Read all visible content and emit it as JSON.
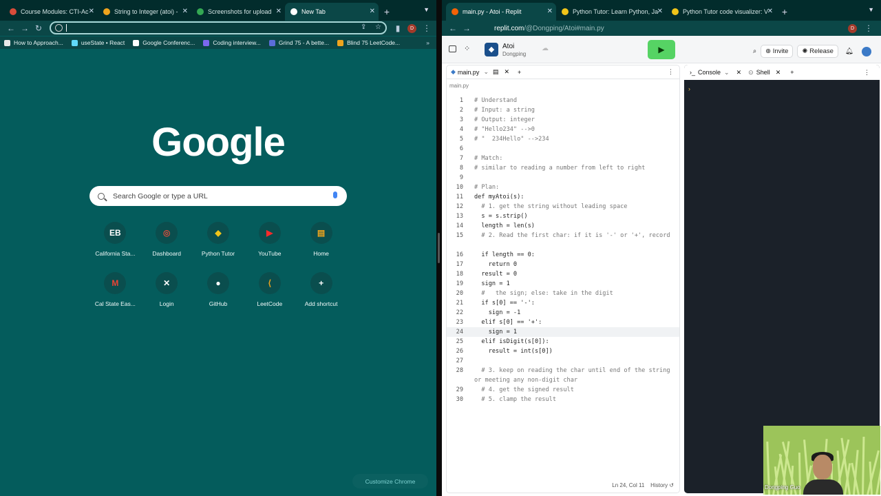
{
  "left": {
    "tabs": [
      {
        "title": "Course Modules: CTI-Ac",
        "color": "#d84c3a"
      },
      {
        "title": "String to Integer (atoi) -",
        "color": "#f0a41d"
      },
      {
        "title": "Screenshots for upload",
        "color": "#34a853"
      },
      {
        "title": "New Tab",
        "color": "#ffffff"
      }
    ],
    "bookmarks": [
      {
        "label": "How to Approach...",
        "color": "#e8e8e8"
      },
      {
        "label": "useState • React",
        "color": "#61dafb"
      },
      {
        "label": "Google Conferenc...",
        "color": "#ffffff"
      },
      {
        "label": "Coding interview...",
        "color": "#7b68ee"
      },
      {
        "label": "Grind 75 - A bette...",
        "color": "#5b6dd8"
      },
      {
        "label": "Blind 75 LeetCode...",
        "color": "#f0a41d"
      }
    ],
    "logo": "Google",
    "search_placeholder": "Search Google or type a URL",
    "shortcuts": [
      {
        "label": "California Sta...",
        "glyph": "EB",
        "color": "#ffffff"
      },
      {
        "label": "Dashboard",
        "glyph": "◎",
        "color": "#d84c3a"
      },
      {
        "label": "Python Tutor",
        "glyph": "◆",
        "color": "#f0c419"
      },
      {
        "label": "YouTube",
        "glyph": "▶",
        "color": "#ff2a2a"
      },
      {
        "label": "Home",
        "glyph": "▤",
        "color": "#f0a41d"
      },
      {
        "label": "Cal State Eas...",
        "glyph": "M",
        "color": "#ea4335"
      },
      {
        "label": "Login",
        "glyph": "✕",
        "color": "#ffffff"
      },
      {
        "label": "GitHub",
        "glyph": "●",
        "color": "#ffffff"
      },
      {
        "label": "LeetCode",
        "glyph": "⟨",
        "color": "#f0a41d"
      },
      {
        "label": "Add shortcut",
        "glyph": "+",
        "color": "#ffffff"
      }
    ],
    "customize": "Customize Chrome"
  },
  "right": {
    "tabs": [
      {
        "title": "main.py - Atoi - Replit",
        "color": "#f26207"
      },
      {
        "title": "Python Tutor: Learn Python, Ja",
        "color": "#f0c419"
      },
      {
        "title": "Python Tutor code visualizer: V",
        "color": "#f0c419"
      }
    ],
    "url_host": "replit.com",
    "url_path": "/@Dongping/Atoi#main.py",
    "repl_name": "Atoi",
    "repl_owner": "Dongping",
    "invite": "Invite",
    "release": "Release",
    "file_tab": "main.py",
    "file_path": "main.py",
    "console_tab": "Console",
    "shell_tab": "Shell",
    "status": "Ln 24, Col 11",
    "history": "History",
    "webcam_name": "Dongping Guo",
    "code": [
      {
        "n": "1",
        "t": "# Understand",
        "c": true
      },
      {
        "n": "2",
        "t": "# Input: a string",
        "c": true
      },
      {
        "n": "3",
        "t": "# Output: integer",
        "c": true
      },
      {
        "n": "4",
        "t": "# \"Hello234\" -->0",
        "c": true
      },
      {
        "n": "5",
        "t": "# \"  234Hello\" -->234",
        "c": true
      },
      {
        "n": "6",
        "t": "",
        "c": false
      },
      {
        "n": "7",
        "t": "# Match:",
        "c": true
      },
      {
        "n": "8",
        "t": "# similar to reading a number from left to right",
        "c": true
      },
      {
        "n": "9",
        "t": "",
        "c": false
      },
      {
        "n": "10",
        "t": "# Plan:",
        "c": true
      },
      {
        "n": "11",
        "t": "def myAtoi(s):",
        "c": false
      },
      {
        "n": "12",
        "t": "  # 1. get the string without leading space",
        "c": true
      },
      {
        "n": "13",
        "t": "  s = s.strip()",
        "c": false
      },
      {
        "n": "14",
        "t": "  length = len(s)",
        "c": false
      },
      {
        "n": "15",
        "t": "  # 2. Read the first char: if it is '-' or '+', record",
        "c": true,
        "w": true
      },
      {
        "n": "16",
        "t": "  if length == 0:",
        "c": false
      },
      {
        "n": "17",
        "t": "    return 0",
        "c": false
      },
      {
        "n": "18",
        "t": "  result = 0",
        "c": false
      },
      {
        "n": "19",
        "t": "  sign = 1",
        "c": false
      },
      {
        "n": "20",
        "t": "  #   the sign; else: take in the digit",
        "c": true
      },
      {
        "n": "21",
        "t": "  if s[0] == '-':",
        "c": false
      },
      {
        "n": "22",
        "t": "    sign = -1",
        "c": false
      },
      {
        "n": "23",
        "t": "  elif s[0] == '+':",
        "c": false
      },
      {
        "n": "24",
        "t": "    sign = 1",
        "c": false,
        "h": true
      },
      {
        "n": "25",
        "t": "  elif isDigit(s[0]):",
        "c": false
      },
      {
        "n": "26",
        "t": "    result = int(s[0])",
        "c": false
      },
      {
        "n": "27",
        "t": "",
        "c": false
      },
      {
        "n": "28",
        "t": "  # 3. keep on reading the char until end of the string or meeting any non-digit char",
        "c": true,
        "w": true
      },
      {
        "n": "29",
        "t": "  # 4. get the signed result",
        "c": true
      },
      {
        "n": "30",
        "t": "  # 5. clamp the result",
        "c": true
      }
    ]
  }
}
